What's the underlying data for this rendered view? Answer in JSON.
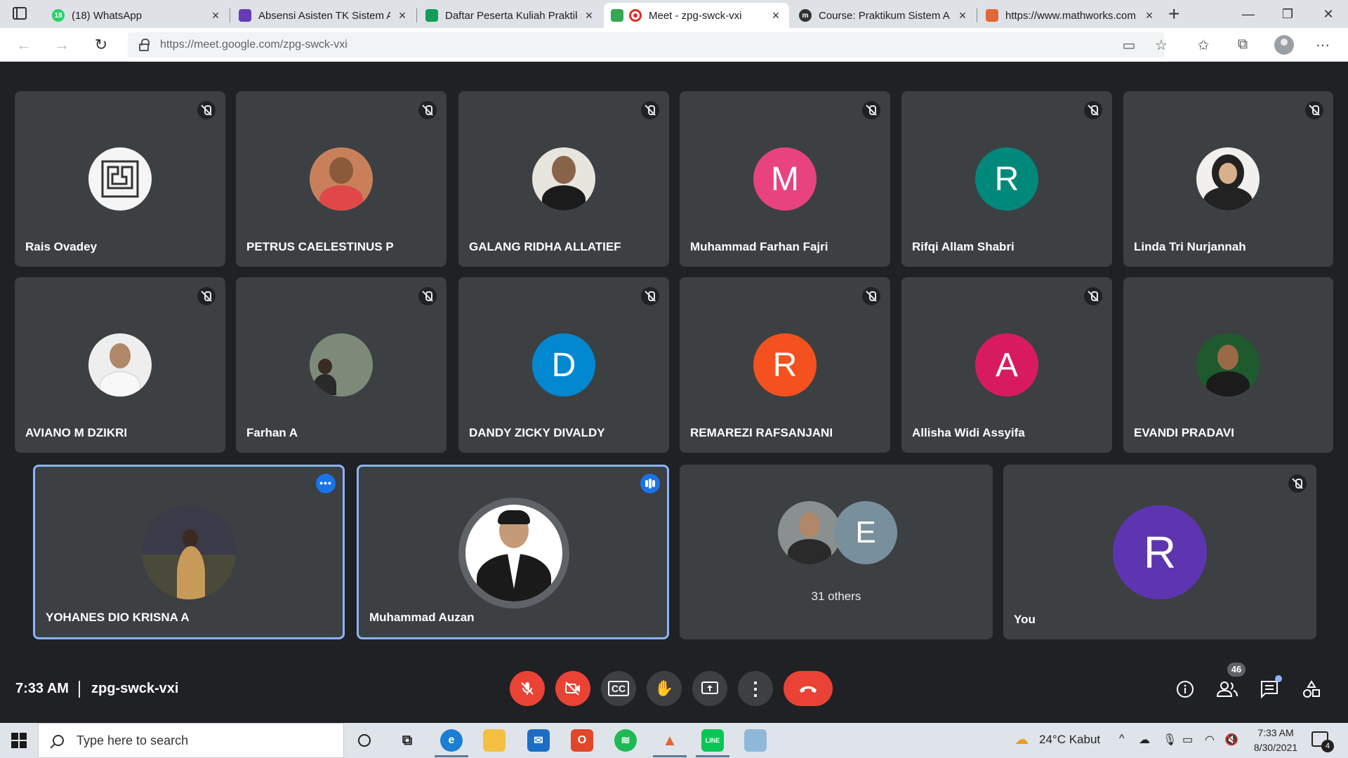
{
  "browser": {
    "tabs": [
      {
        "label": "(18) WhatsApp",
        "fav_text": "18",
        "fav_color": "#25d366"
      },
      {
        "label": "Absensi Asisten TK Sistem A",
        "fav_text": "",
        "fav_color": "#673ab7"
      },
      {
        "label": "Daftar Peserta Kuliah Praktik",
        "fav_text": "",
        "fav_color": "#0f9d58"
      },
      {
        "label": "Meet - zpg-swck-vxi",
        "fav_text": "",
        "fav_color": "#34a853"
      },
      {
        "label": "Course: Praktikum Sistem A",
        "fav_text": "m",
        "fav_color": "#333333"
      },
      {
        "label": "https://www.mathworks.com",
        "fav_text": "",
        "fav_color": "#e16737"
      }
    ],
    "close_glyph": "×",
    "new_tab_glyph": "+",
    "url": "https://meet.google.com/zpg-swck-vxi"
  },
  "meet": {
    "participants_row1": [
      {
        "name": "Rais Ovadey",
        "avatar": "photo",
        "photo_bg": "#f5f5f5",
        "photo_fg": "#333333"
      },
      {
        "name": "PETRUS CAELESTINUS P",
        "avatar": "photo",
        "photo_bg": "#c9805a",
        "photo_fg": "#3a2a22"
      },
      {
        "name": "GALANG RIDHA ALLATIEF",
        "avatar": "photo",
        "photo_bg": "#e8e4de",
        "photo_fg": "#4a3a30"
      },
      {
        "name": "Muhammad Farhan Fajri",
        "avatar": "letter",
        "letter": "M",
        "color": "#e8437e"
      },
      {
        "name": "Rifqi Allam Shabri",
        "avatar": "letter",
        "letter": "R",
        "color": "#00897b"
      },
      {
        "name": "Linda Tri Nurjannah",
        "avatar": "photo",
        "photo_bg": "#f2f0ee",
        "photo_fg": "#222222"
      }
    ],
    "participants_row2": [
      {
        "name": "AVIANO M DZIKRI",
        "avatar": "photo",
        "photo_bg": "#eeeeee",
        "photo_fg": "#7a6a5a"
      },
      {
        "name": "Farhan A",
        "avatar": "photo",
        "photo_bg": "#7d8a7a",
        "photo_fg": "#3a3a30"
      },
      {
        "name": "DANDY ZICKY DIVALDY",
        "avatar": "letter",
        "letter": "D",
        "color": "#0288d1"
      },
      {
        "name": "REMAREZI RAFSANJANI",
        "avatar": "letter",
        "letter": "R",
        "color": "#f4511e"
      },
      {
        "name": "Allisha Widi Assyifa",
        "avatar": "letter",
        "letter": "A",
        "color": "#d81b60"
      },
      {
        "name": "EVANDI PRADAVI",
        "avatar": "photo",
        "photo_bg": "#1e5a2e",
        "photo_fg": "#3a2a22"
      }
    ],
    "featured": [
      {
        "name": "YOHANES DIO KRISNA A",
        "badge": "more"
      },
      {
        "name": "Muhammad Auzan",
        "badge": "speaking"
      }
    ],
    "others": {
      "letter": "E",
      "letter_color": "#78909c",
      "count_label": "31 others"
    },
    "self": {
      "name": "You",
      "letter": "R",
      "color": "#5e35b1"
    },
    "more_glyph": "•••",
    "time": "7:33 AM",
    "meeting_code": "zpg-swck-vxi",
    "participant_count": "46",
    "controls": {
      "mic_icon": "🎙",
      "camera_icon": "📷",
      "captions_icon": "CC",
      "hand_icon": "✋",
      "present_icon": "⬆",
      "more_icon": "⋮",
      "hangup_icon": "☎"
    },
    "right_icons": {
      "info": "ⓘ",
      "people": "👥",
      "chat": "💬",
      "activities": "⚙"
    }
  },
  "taskbar": {
    "search_placeholder": "Type here to search",
    "weather": "24°C  Kabut",
    "time": "7:33 AM",
    "date": "8/30/2021",
    "notifications": "4"
  }
}
